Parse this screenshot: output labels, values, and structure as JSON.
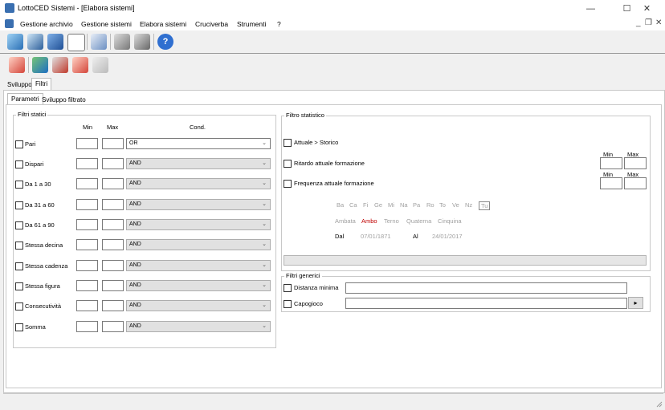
{
  "window": {
    "title": "LottoCED Sistemi - [Elabora sistemi]",
    "controls": {
      "minimize": "—",
      "maximize": "☐",
      "close": "✕"
    },
    "mdi_controls": {
      "minimize": "_",
      "restore": "❐",
      "close": "✕"
    }
  },
  "menu": [
    "Gestione archivio",
    "Gestione sistemi",
    "Elabora sistemi",
    "Cruciverba",
    "Strumenti",
    "?"
  ],
  "tabs": {
    "outer": [
      "Sviluppo",
      "Filtri"
    ],
    "inner": [
      "Parametri",
      "Sviluppo filtrato"
    ]
  },
  "filtri_statici": {
    "label": "Filtri statici",
    "headers": {
      "min": "Min",
      "max": "Max",
      "cond": "Cond."
    },
    "rows": [
      {
        "label": "Pari",
        "cond": "OR"
      },
      {
        "label": "Dispari",
        "cond": "AND"
      },
      {
        "label": "Da 1 a 30",
        "cond": "AND"
      },
      {
        "label": "Da 31 a 60",
        "cond": "AND"
      },
      {
        "label": "Da 61 a 90",
        "cond": "AND"
      },
      {
        "label": "Stessa decina",
        "cond": "AND"
      },
      {
        "label": "Stessa cadenza",
        "cond": "AND"
      },
      {
        "label": "Stessa figura",
        "cond": "AND"
      },
      {
        "label": "Consecutività",
        "cond": "AND"
      },
      {
        "label": "Somma",
        "cond": "AND"
      }
    ]
  },
  "filtro_statistico": {
    "label": "Filtro statistico",
    "options": [
      "Attuale > Storico",
      "Ritardo attuale formazione",
      "Frequenza attuale formazione"
    ],
    "min_label": "Min",
    "max_label": "Max",
    "ruote": [
      "Ba",
      "Ca",
      "Fi",
      "Ge",
      "Mi",
      "Na",
      "Pa",
      "Ro",
      "To",
      "Ve",
      "Nz",
      "Tu"
    ],
    "sorti": [
      "Ambata",
      "Ambo",
      "Terno",
      "Quaterna",
      "Cinquina"
    ],
    "selected_sorte": "Ambo",
    "dal_label": "Dal",
    "dal_value": "07/01/1871",
    "al_label": "Al",
    "al_value": "24/01/2017"
  },
  "filtri_generici": {
    "label": "Filtri generici",
    "options": [
      "Distanza minima",
      "Capogioco"
    ],
    "button": "▸"
  },
  "colors": {
    "selected_sorte": "#c00000",
    "disabled": "#a0a0a0"
  }
}
